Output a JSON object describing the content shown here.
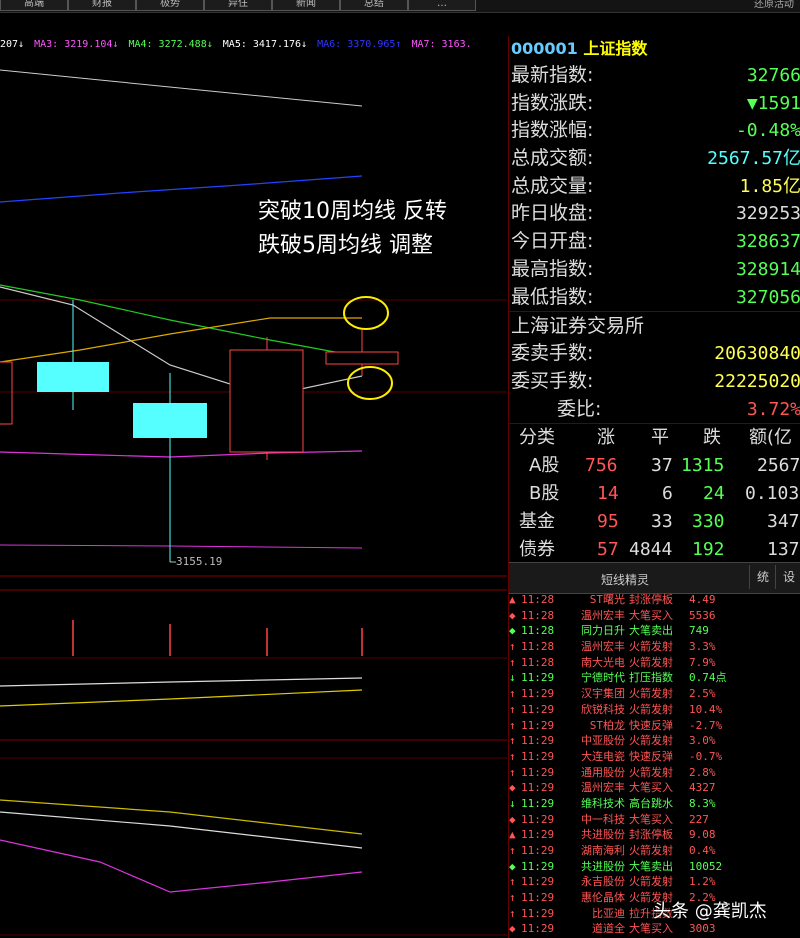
{
  "top_tabs": [
    "高端",
    "财报",
    "极势",
    "异住",
    "新闻",
    "总结",
    "…",
    "还原活动"
  ],
  "ma_bar": [
    {
      "text": "207↓",
      "color": "#ffffff"
    },
    {
      "text": "MA3: 3219.104↓",
      "color": "#ff55ff"
    },
    {
      "text": "MA4: 3272.488↓",
      "color": "#55ff55"
    },
    {
      "text": "MA5: 3417.176↓",
      "color": "#ffffff"
    },
    {
      "text": "MA6: 3370.965↑",
      "color": "#3333ff"
    },
    {
      "text": "MA7: 3163.",
      "color": "#ff55ff"
    }
  ],
  "annotation": {
    "line1": "突破10周均线 反转",
    "line2": "跌破5周均线  调整"
  },
  "low_price_label": "3155.19",
  "index": {
    "code": "000001",
    "name": "上证指数"
  },
  "quote_rows": [
    {
      "key": "最新指数:",
      "value": "32766",
      "color": "#55ff55"
    },
    {
      "key": "指数涨跌:",
      "value": "▼1591",
      "color": "#55ff55"
    },
    {
      "key": "指数涨幅:",
      "value": "-0.48%",
      "color": "#55ff55"
    },
    {
      "key": "总成交额:",
      "value": "2567.57亿",
      "color": "#55ffff"
    },
    {
      "key": "总成交量:",
      "value": "1.85亿",
      "color": "#ffff55"
    },
    {
      "key": "昨日收盘:",
      "value": "329253",
      "color": "#dddddd"
    },
    {
      "key": "今日开盘:",
      "value": "328637",
      "color": "#55ff55"
    },
    {
      "key": "最高指数:",
      "value": "328914",
      "color": "#55ff55"
    },
    {
      "key": "最低指数:",
      "value": "327056",
      "color": "#55ff55"
    }
  ],
  "exchange": "上海证券交易所",
  "order_rows": [
    {
      "key": "委卖手数:",
      "value": "20630840",
      "color": "#ffff55"
    },
    {
      "key": "委买手数:",
      "value": "22225020",
      "color": "#ffff55"
    },
    {
      "key": "委比:",
      "value": "3.72%",
      "color": "#ff5555"
    }
  ],
  "breadth": {
    "headers": [
      "分类",
      "涨",
      "平",
      "跌",
      "额(亿"
    ],
    "rows": [
      [
        "A股",
        "756",
        "37",
        "1315",
        "2567"
      ],
      [
        "B股",
        "14",
        "6",
        "24",
        "0.103"
      ],
      [
        "基金",
        "95",
        "33",
        "330",
        "347"
      ],
      [
        "债券",
        "57",
        "4844",
        "192",
        "137"
      ]
    ]
  },
  "ticker_title": "短线精灵",
  "ticker_buttons": [
    "统",
    "设"
  ],
  "ticker": [
    {
      "mark": "▲",
      "time": "11:28",
      "name": "ST曙光",
      "event": "封涨停板",
      "value": "4.49",
      "color": "#ff5555"
    },
    {
      "mark": "◆",
      "time": "11:28",
      "name": "温州宏丰",
      "event": "大笔买入",
      "value": "5536",
      "color": "#ff5555"
    },
    {
      "mark": "◆",
      "time": "11:28",
      "name": "同力日升",
      "event": "大笔卖出",
      "value": "749",
      "color": "#55ff55"
    },
    {
      "mark": "↑",
      "time": "11:28",
      "name": "温州宏丰",
      "event": "火箭发射",
      "value": "3.3%",
      "color": "#ff5555"
    },
    {
      "mark": "↑",
      "time": "11:28",
      "name": "南大光电",
      "event": "火箭发射",
      "value": "7.9%",
      "color": "#ff5555"
    },
    {
      "mark": "↓",
      "time": "11:29",
      "name": "宁德时代",
      "event": "打压指数",
      "value": "0.74点",
      "color": "#55ff55"
    },
    {
      "mark": "↑",
      "time": "11:29",
      "name": "汉宇集团",
      "event": "火箭发射",
      "value": "2.5%",
      "color": "#ff5555"
    },
    {
      "mark": "↑",
      "time": "11:29",
      "name": "欣锐科技",
      "event": "火箭发射",
      "value": "10.4%",
      "color": "#ff5555"
    },
    {
      "mark": "↑",
      "time": "11:29",
      "name": "ST柏龙",
      "event": "快速反弹",
      "value": "-2.7%",
      "color": "#ff5555"
    },
    {
      "mark": "↑",
      "time": "11:29",
      "name": "中亚股份",
      "event": "火箭发射",
      "value": "3.0%",
      "color": "#ff5555"
    },
    {
      "mark": "↑",
      "time": "11:29",
      "name": "大连电瓷",
      "event": "快速反弹",
      "value": "-0.7%",
      "color": "#ff5555"
    },
    {
      "mark": "↑",
      "time": "11:29",
      "name": "通用股份",
      "event": "火箭发射",
      "value": "2.8%",
      "color": "#ff5555"
    },
    {
      "mark": "◆",
      "time": "11:29",
      "name": "温州宏丰",
      "event": "大笔买入",
      "value": "4327",
      "color": "#ff5555"
    },
    {
      "mark": "↓",
      "time": "11:29",
      "name": "维科技术",
      "event": "高台跳水",
      "value": "8.3%",
      "color": "#55ff55"
    },
    {
      "mark": "◆",
      "time": "11:29",
      "name": "中一科技",
      "event": "大笔买入",
      "value": "227",
      "color": "#ff5555"
    },
    {
      "mark": "▲",
      "time": "11:29",
      "name": "共进股份",
      "event": "封涨停板",
      "value": "9.08",
      "color": "#ff5555"
    },
    {
      "mark": "↑",
      "time": "11:29",
      "name": "湖南海利",
      "event": "火箭发射",
      "value": "0.4%",
      "color": "#ff5555"
    },
    {
      "mark": "◆",
      "time": "11:29",
      "name": "共进股份",
      "event": "大笔卖出",
      "value": "10052",
      "color": "#55ff55"
    },
    {
      "mark": "↑",
      "time": "11:29",
      "name": "永吉股份",
      "event": "火箭发射",
      "value": "1.2%",
      "color": "#ff5555"
    },
    {
      "mark": "↑",
      "time": "11:29",
      "name": "惠伦晶体",
      "event": "火箭发射",
      "value": "2.2%",
      "color": "#ff5555"
    },
    {
      "mark": "↑",
      "time": "11:29",
      "name": "比亚迪",
      "event": "拉升指数",
      "value": "",
      "color": "#ff5555"
    },
    {
      "mark": "◆",
      "time": "11:29",
      "name": "道道全",
      "event": "大笔买入",
      "value": "3003",
      "color": "#ff5555"
    }
  ],
  "watermark": "头条 @龚凯杰",
  "colors": {
    "up": "#ff5555",
    "down": "#55ff55",
    "cyan_candle": "#55ffff",
    "highlight_circle": "#ffee00",
    "grid": "#660000"
  }
}
